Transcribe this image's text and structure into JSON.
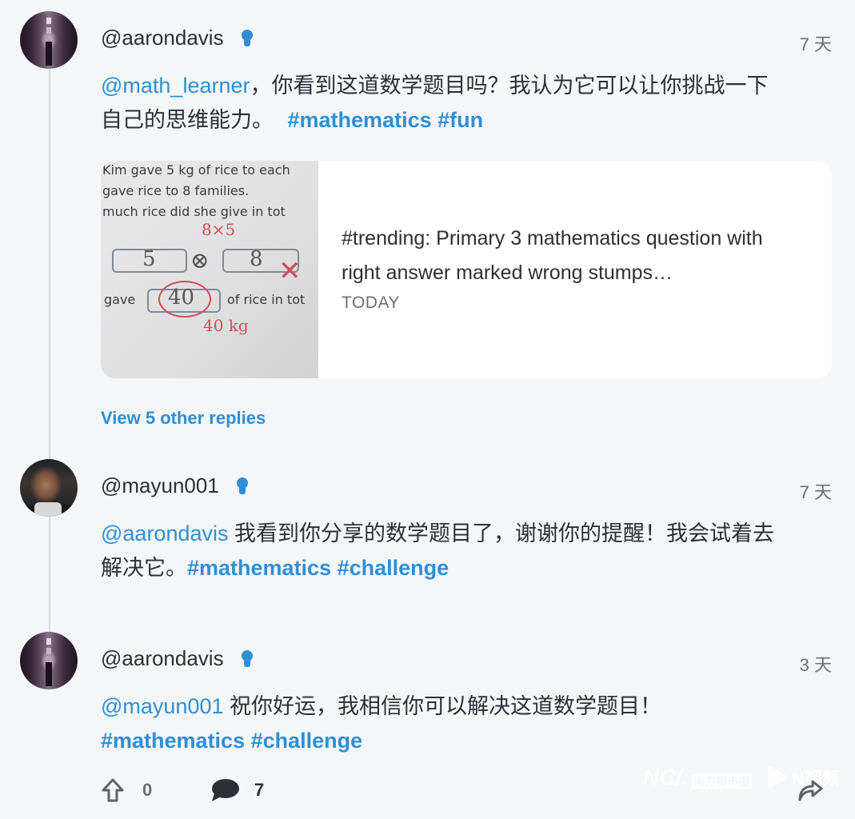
{
  "posts": [
    {
      "username": "@aarondavis",
      "badge_icon": "lightbulb-icon",
      "timestamp": "7 天",
      "mention": "@math_learner",
      "text_line1_after_mention": "，你看到这道数学题目吗？我认为它可以让你挑战一下",
      "text_line2": "自己的思维能力。",
      "hashtags": [
        "#mathematics",
        "#fun"
      ],
      "link_card": {
        "thumbnail_text": {
          "line1": "Kim gave 5 kg of rice to each",
          "line2": "gave rice to 8 families.",
          "line3": "much rice did she give in tot",
          "handwritten_top": "8×5",
          "box1": "5",
          "operator": "⊗",
          "box2": "8",
          "gave_label": "gave",
          "answer": "40",
          "after_answer": "of rice in tot",
          "handwritten_bottom": "40 kg"
        },
        "title": "#trending: Primary 3 mathematics question with right answer marked wrong stumps…",
        "date": "TODAY"
      }
    },
    {
      "username": "@mayun001",
      "badge_icon": "lightbulb-icon",
      "timestamp": "7 天",
      "mention": "@aarondavis",
      "text_line1_after_mention": " 我看到你分享的数学题目了，谢谢你的提醒！我会试着去",
      "text_line2": "解决它。",
      "hashtags": [
        "#mathematics",
        "#challenge"
      ]
    },
    {
      "username": "@aarondavis",
      "badge_icon": "lightbulb-icon",
      "timestamp": "3 天",
      "mention": "@mayun001",
      "text_line1_after_mention": " 祝你好运，我相信你可以解决这道数学题目！",
      "hashtags": [
        "#mathematics",
        "#challenge"
      ]
    }
  ],
  "view_replies": "View 5 other replies",
  "actions": {
    "upvote_count": "0",
    "comment_count": "7"
  },
  "watermark": {
    "logo1_text": "NC/.",
    "logo1_name": "南方都市报",
    "logo2_text": "N视频"
  },
  "colors": {
    "accent": "#2e8fd6",
    "text": "#2d2f37",
    "muted": "#6b6e75",
    "background": "#f5f6f8"
  }
}
